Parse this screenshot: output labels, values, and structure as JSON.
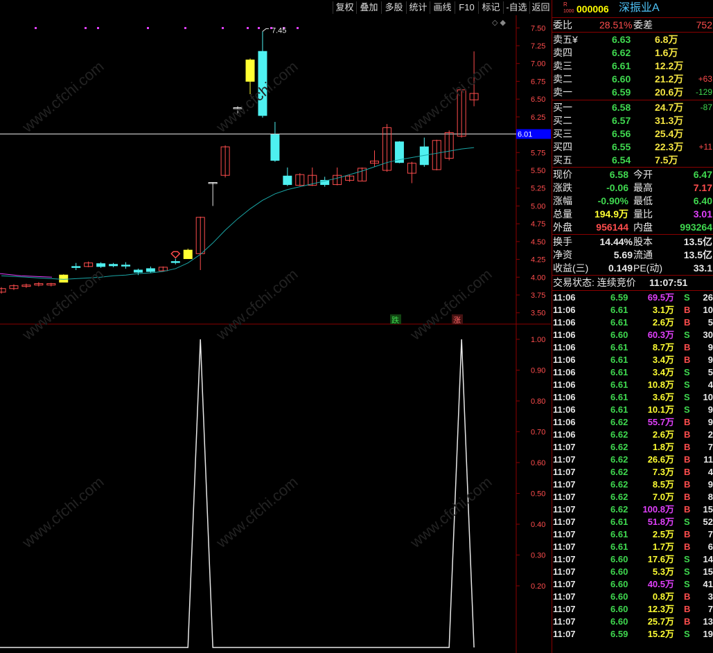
{
  "toolbar": {
    "buttons": [
      "复权",
      "叠加",
      "多股",
      "统计",
      "画线",
      "F10",
      "标记",
      "-自选",
      "返回"
    ]
  },
  "chart": {
    "current_price_marker": "6.01",
    "high_label": "7.45",
    "y_ticks_main": [
      "7.50",
      "7.25",
      "7.00",
      "6.75",
      "6.50",
      "6.25",
      "6.00",
      "5.75",
      "5.50",
      "5.25",
      "5.00",
      "4.75",
      "4.50",
      "4.25",
      "4.00",
      "3.75",
      "3.50"
    ],
    "y_ticks_sub": [
      "1.00",
      "0.90",
      "0.80",
      "0.70",
      "0.60",
      "0.50",
      "0.40",
      "0.30",
      "0.20"
    ],
    "markers": {
      "down": "跌",
      "up": "涨"
    },
    "watermark": "www.cfchi.com"
  },
  "chart_data": {
    "type": "candlestick",
    "ylim": [
      3.4,
      7.6
    ],
    "current_line": 6.01,
    "candles": [
      {
        "o": 3.79,
        "c": 3.84,
        "h": 3.86,
        "l": 3.77,
        "color": "red"
      },
      {
        "o": 3.84,
        "c": 3.88,
        "h": 3.9,
        "l": 3.82,
        "color": "red"
      },
      {
        "o": 3.87,
        "c": 3.89,
        "h": 3.91,
        "l": 3.85,
        "color": "red"
      },
      {
        "o": 3.89,
        "c": 3.91,
        "h": 3.93,
        "l": 3.87,
        "color": "red"
      },
      {
        "o": 3.89,
        "c": 3.91,
        "h": 3.92,
        "l": 3.87,
        "color": "red"
      },
      {
        "o": 3.93,
        "c": 4.03,
        "h": 4.04,
        "l": 3.93,
        "color": "yellow"
      },
      {
        "o": 4.15,
        "c": 4.14,
        "h": 4.2,
        "l": 4.1,
        "color": "cyan"
      },
      {
        "o": 4.15,
        "c": 4.2,
        "h": 4.22,
        "l": 4.14,
        "color": "red"
      },
      {
        "o": 4.19,
        "c": 4.15,
        "h": 4.21,
        "l": 4.13,
        "color": "cyan"
      },
      {
        "o": 4.18,
        "c": 4.16,
        "h": 4.2,
        "l": 4.14,
        "color": "cyan"
      },
      {
        "o": 4.17,
        "c": 4.16,
        "h": 4.21,
        "l": 4.12,
        "color": "cyan"
      },
      {
        "o": 4.1,
        "c": 4.07,
        "h": 4.12,
        "l": 4.03,
        "color": "cyan"
      },
      {
        "o": 4.12,
        "c": 4.08,
        "h": 4.15,
        "l": 4.06,
        "color": "cyan"
      },
      {
        "o": 4.09,
        "c": 4.14,
        "h": 4.15,
        "l": 4.09,
        "color": "red"
      },
      {
        "o": 4.22,
        "c": 4.21,
        "h": 4.26,
        "l": 4.18,
        "color": "cyan"
      },
      {
        "o": 4.26,
        "c": 4.38,
        "h": 4.4,
        "l": 4.26,
        "color": "yellow"
      },
      {
        "o": 4.33,
        "c": 4.84,
        "h": 4.85,
        "l": 4.1,
        "color": "red"
      },
      {
        "o": 5.33,
        "c": 5.33,
        "h": 5.33,
        "l": 5.0,
        "color": "white"
      },
      {
        "o": 5.43,
        "c": 5.83,
        "h": 5.85,
        "l": 5.4,
        "color": "red"
      },
      {
        "o": 6.38,
        "c": 6.38,
        "h": 6.4,
        "l": 6.3,
        "color": "white"
      },
      {
        "o": 6.75,
        "c": 7.05,
        "h": 7.07,
        "l": 6.57,
        "color": "yellow"
      },
      {
        "o": 7.17,
        "c": 6.27,
        "h": 7.45,
        "l": 6.24,
        "color": "cyan"
      },
      {
        "o": 6.0,
        "c": 5.64,
        "h": 6.18,
        "l": 5.62,
        "color": "cyan"
      },
      {
        "o": 5.42,
        "c": 5.3,
        "h": 5.54,
        "l": 5.28,
        "color": "cyan"
      },
      {
        "o": 5.29,
        "c": 5.44,
        "h": 5.46,
        "l": 5.28,
        "color": "red"
      },
      {
        "o": 5.29,
        "c": 5.43,
        "h": 5.54,
        "l": 5.28,
        "color": "red"
      },
      {
        "o": 5.36,
        "c": 5.3,
        "h": 5.41,
        "l": 5.27,
        "color": "cyan"
      },
      {
        "o": 5.3,
        "c": 5.43,
        "h": 5.54,
        "l": 5.29,
        "color": "red"
      },
      {
        "o": 5.36,
        "c": 5.42,
        "h": 5.44,
        "l": 5.34,
        "color": "red"
      },
      {
        "o": 5.35,
        "c": 5.53,
        "h": 5.54,
        "l": 5.35,
        "color": "red"
      },
      {
        "o": 5.6,
        "c": 5.63,
        "h": 5.78,
        "l": 5.55,
        "color": "red"
      },
      {
        "o": 5.5,
        "c": 6.1,
        "h": 6.15,
        "l": 5.48,
        "color": "red"
      },
      {
        "o": 5.9,
        "c": 5.61,
        "h": 5.91,
        "l": 5.6,
        "color": "cyan"
      },
      {
        "o": 5.46,
        "c": 5.6,
        "h": 5.62,
        "l": 5.32,
        "color": "red"
      },
      {
        "o": 5.83,
        "c": 5.58,
        "h": 5.96,
        "l": 5.55,
        "color": "cyan"
      },
      {
        "o": 5.51,
        "c": 5.92,
        "h": 5.93,
        "l": 5.5,
        "color": "red"
      },
      {
        "o": 5.67,
        "c": 6.03,
        "h": 6.06,
        "l": 5.64,
        "color": "red"
      },
      {
        "o": 5.98,
        "c": 6.63,
        "h": 6.64,
        "l": 5.96,
        "color": "red"
      },
      {
        "o": 6.49,
        "c": 6.58,
        "h": 7.17,
        "l": 6.4,
        "color": "red"
      }
    ],
    "ma": [
      4.02,
      4.01,
      4.0,
      3.99,
      3.98,
      3.97,
      3.98,
      3.99,
      4.0,
      4.02,
      4.03,
      4.05,
      4.06,
      4.08,
      4.12,
      4.2,
      4.32,
      4.48,
      4.66,
      4.82,
      4.96,
      5.08,
      5.17,
      5.23,
      5.27,
      5.31,
      5.35,
      5.39,
      5.44,
      5.49,
      5.55,
      5.61,
      5.65,
      5.68,
      5.71,
      5.74,
      5.77,
      5.8,
      5.82
    ],
    "sub_series": [
      0,
      0,
      0,
      0,
      0,
      0,
      0,
      0,
      0,
      0,
      0,
      0,
      0,
      0,
      0,
      0,
      1,
      0,
      0,
      0,
      0,
      0,
      0,
      0,
      0,
      0,
      0,
      0,
      0,
      0,
      0,
      0,
      0,
      0,
      0,
      0,
      0,
      1,
      0
    ]
  },
  "quote": {
    "code": "000006",
    "name": "深振业A",
    "code_badge": "R",
    "code_badge2": "1000",
    "webi_label": "委比",
    "webi_value": "28.51%",
    "weicha_label": "委差",
    "weicha_value": "752",
    "sell": [
      {
        "label": "卖五",
        "extra": "¥",
        "price": "6.63",
        "vol": "6.8万",
        "chg": ""
      },
      {
        "label": "卖四",
        "extra": "",
        "price": "6.62",
        "vol": "1.6万",
        "chg": ""
      },
      {
        "label": "卖三",
        "extra": "",
        "price": "6.61",
        "vol": "12.2万",
        "chg": ""
      },
      {
        "label": "卖二",
        "extra": "",
        "price": "6.60",
        "vol": "21.2万",
        "chg": "+63"
      },
      {
        "label": "卖一",
        "extra": "",
        "price": "6.59",
        "vol": "20.6万",
        "chg": "-129"
      }
    ],
    "buy": [
      {
        "label": "买一",
        "price": "6.58",
        "vol": "24.7万",
        "chg": "-87"
      },
      {
        "label": "买二",
        "price": "6.57",
        "vol": "31.3万",
        "chg": ""
      },
      {
        "label": "买三",
        "price": "6.56",
        "vol": "25.4万",
        "chg": ""
      },
      {
        "label": "买四",
        "price": "6.55",
        "vol": "22.3万",
        "chg": "+11"
      },
      {
        "label": "买五",
        "price": "6.54",
        "vol": "7.5万",
        "chg": ""
      }
    ],
    "stats": [
      {
        "l1": "现价",
        "v1": "6.58",
        "c1": "green",
        "l2": "今开",
        "v2": "6.47",
        "c2": "green"
      },
      {
        "l1": "涨跌",
        "v1": "-0.06",
        "c1": "green",
        "l2": "最高",
        "v2": "7.17",
        "c2": "red"
      },
      {
        "l1": "涨幅",
        "v1": "-0.90%",
        "c1": "green",
        "l2": "最低",
        "v2": "6.40",
        "c2": "green"
      },
      {
        "l1": "总量",
        "v1": "194.9万",
        "c1": "yellow",
        "l2": "量比",
        "v2": "3.01",
        "c2": "magenta"
      },
      {
        "l1": "外盘",
        "v1": "956144",
        "c1": "red",
        "l2": "内盘",
        "v2": "993264",
        "c2": "green"
      }
    ],
    "stats2": [
      {
        "l1": "换手",
        "v1": "14.44%",
        "l2": "股本",
        "v2": "13.5亿"
      },
      {
        "l1": "净资",
        "v1": "5.69",
        "l2": "流通",
        "v2": "13.5亿"
      },
      {
        "l1": "收益(三)",
        "v1": "0.149",
        "l2": "PE(动)",
        "v2": "33.1"
      }
    ],
    "status_label": "交易状态: 连续竞价",
    "status_time": "11:07:51"
  },
  "trades": [
    {
      "t": "11:06",
      "p": "6.59",
      "v": "69.5万",
      "vc": "magenta",
      "s": "S",
      "n": "26"
    },
    {
      "t": "11:06",
      "p": "6.61",
      "v": "3.1万",
      "vc": "yellow",
      "s": "B",
      "n": "10"
    },
    {
      "t": "11:06",
      "p": "6.61",
      "v": "2.6万",
      "vc": "yellow",
      "s": "B",
      "n": "5"
    },
    {
      "t": "11:06",
      "p": "6.60",
      "v": "60.3万",
      "vc": "magenta",
      "s": "S",
      "n": "30"
    },
    {
      "t": "11:06",
      "p": "6.61",
      "v": "8.7万",
      "vc": "yellow",
      "s": "B",
      "n": "9"
    },
    {
      "t": "11:06",
      "p": "6.61",
      "v": "3.4万",
      "vc": "yellow",
      "s": "B",
      "n": "9"
    },
    {
      "t": "11:06",
      "p": "6.61",
      "v": "3.4万",
      "vc": "yellow",
      "s": "S",
      "n": "5"
    },
    {
      "t": "11:06",
      "p": "6.61",
      "v": "10.8万",
      "vc": "yellow",
      "s": "S",
      "n": "4"
    },
    {
      "t": "11:06",
      "p": "6.61",
      "v": "3.6万",
      "vc": "yellow",
      "s": "S",
      "n": "10"
    },
    {
      "t": "11:06",
      "p": "6.61",
      "v": "10.1万",
      "vc": "yellow",
      "s": "S",
      "n": "9"
    },
    {
      "t": "11:06",
      "p": "6.62",
      "v": "55.7万",
      "vc": "magenta",
      "s": "B",
      "n": "9"
    },
    {
      "t": "11:06",
      "p": "6.62",
      "v": "2.6万",
      "vc": "yellow",
      "s": "B",
      "n": "2"
    },
    {
      "t": "11:07",
      "p": "6.62",
      "v": "1.8万",
      "vc": "yellow",
      "s": "B",
      "n": "7"
    },
    {
      "t": "11:07",
      "p": "6.62",
      "v": "26.6万",
      "vc": "yellow",
      "s": "B",
      "n": "11"
    },
    {
      "t": "11:07",
      "p": "6.62",
      "v": "7.3万",
      "vc": "yellow",
      "s": "B",
      "n": "4"
    },
    {
      "t": "11:07",
      "p": "6.62",
      "v": "8.5万",
      "vc": "yellow",
      "s": "B",
      "n": "9"
    },
    {
      "t": "11:07",
      "p": "6.62",
      "v": "7.0万",
      "vc": "yellow",
      "s": "B",
      "n": "8"
    },
    {
      "t": "11:07",
      "p": "6.62",
      "v": "100.8万",
      "vc": "magenta",
      "s": "B",
      "n": "15"
    },
    {
      "t": "11:07",
      "p": "6.61",
      "v": "51.8万",
      "vc": "magenta",
      "s": "S",
      "n": "52"
    },
    {
      "t": "11:07",
      "p": "6.61",
      "v": "2.5万",
      "vc": "yellow",
      "s": "B",
      "n": "7"
    },
    {
      "t": "11:07",
      "p": "6.61",
      "v": "1.7万",
      "vc": "yellow",
      "s": "B",
      "n": "6"
    },
    {
      "t": "11:07",
      "p": "6.60",
      "v": "17.6万",
      "vc": "yellow",
      "s": "S",
      "n": "14"
    },
    {
      "t": "11:07",
      "p": "6.60",
      "v": "5.3万",
      "vc": "yellow",
      "s": "S",
      "n": "15"
    },
    {
      "t": "11:07",
      "p": "6.60",
      "v": "40.5万",
      "vc": "magenta",
      "s": "S",
      "n": "41"
    },
    {
      "t": "11:07",
      "p": "6.60",
      "v": "0.8万",
      "vc": "yellow",
      "s": "B",
      "n": "3"
    },
    {
      "t": "11:07",
      "p": "6.60",
      "v": "12.3万",
      "vc": "yellow",
      "s": "B",
      "n": "7"
    },
    {
      "t": "11:07",
      "p": "6.60",
      "v": "25.7万",
      "vc": "yellow",
      "s": "B",
      "n": "13"
    },
    {
      "t": "11:07",
      "p": "6.59",
      "v": "15.2万",
      "vc": "yellow",
      "s": "S",
      "n": "19"
    }
  ],
  "colors": {
    "red": "#ff4d4d",
    "green": "#3fd84f",
    "cyan": "#4ef0f0",
    "yellow": "#ffff33",
    "magenta": "#e040fb",
    "grid": "#8b0000"
  }
}
